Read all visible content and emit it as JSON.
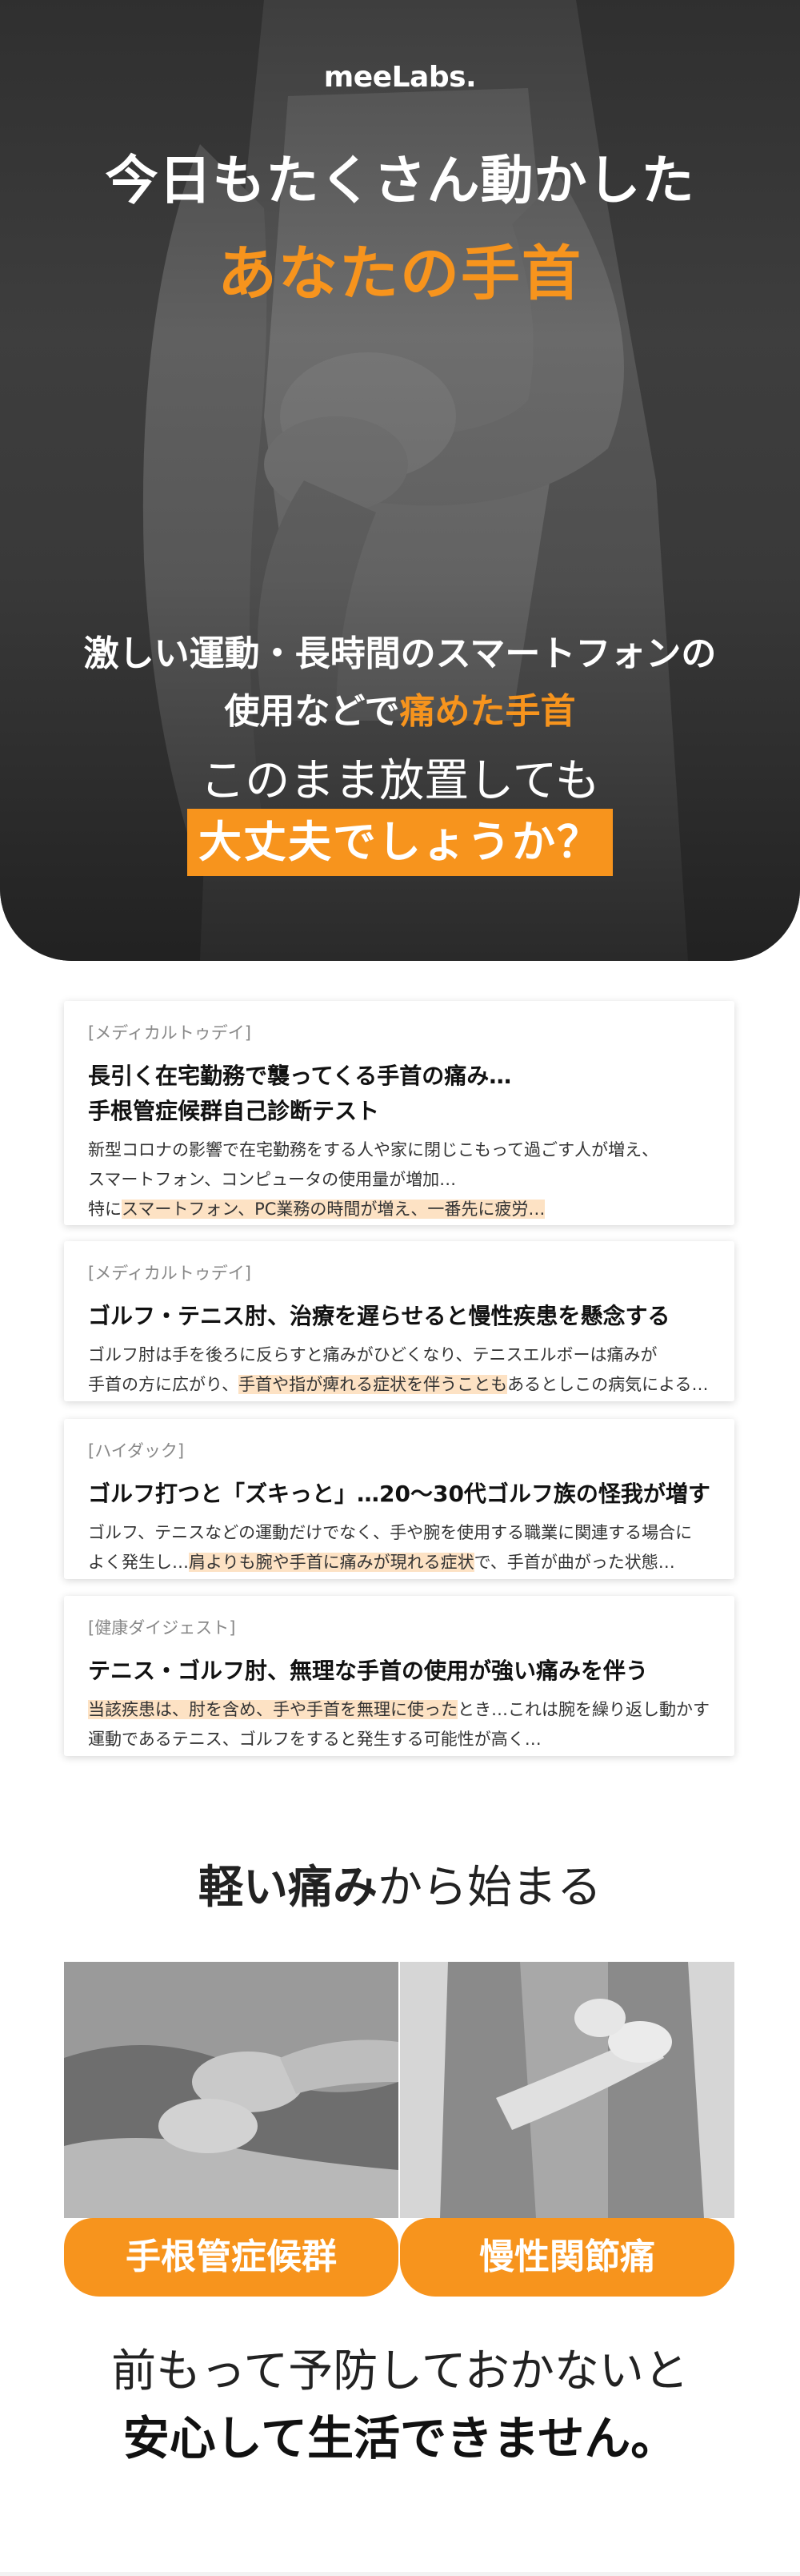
{
  "brand": {
    "logo": "meeLabs."
  },
  "hero": {
    "headline_line1": "今日もたくさん動かした",
    "headline_line2": "あなたの手首",
    "sub_line1": "激しい運動・長時間のスマートフォンの",
    "sub_line2_prefix": "使用などで",
    "sub_line2_highlight": "痛めた手首",
    "question_line1": "このまま放置しても",
    "question_line2": "大丈夫でしょうか？"
  },
  "news": [
    {
      "source": "[メディカルトゥデイ]",
      "title_line1": "長引く在宅勤務で襲ってくる手首の痛み…",
      "title_line2": "手根管症候群自己診断テスト",
      "body_line1": "新型コロナの影響で在宅勤務をする人や家に閉じこもって過ごす人が増え、",
      "body_line2": "スマートフォン、コンピュータの使用量が増加…",
      "body_line3_prefix": "特に",
      "body_line3_highlight": "スマートフォン、PC業務の時間が増え、一番先に疲労…"
    },
    {
      "source": "[メディカルトゥデイ]",
      "title": "ゴルフ・テニス肘、治療を遅らせると慢性疾患を懸念する",
      "body_line1": "ゴルフ肘は手を後ろに反らすと痛みがひどくなり、テニスエルボーは痛みが",
      "body_line2_prefix": "手首の方に広がり、",
      "body_line2_highlight": "手首や指が痺れる症状を伴うことも",
      "body_line2_suffix": "あるとしこの病気による…"
    },
    {
      "source": "[ハイダック]",
      "title": "ゴルフ打つと「ズキっと」…20～30代ゴルフ族の怪我が増す",
      "body_line1": "ゴルフ、テニスなどの運動だけでなく、手や腕を使用する職業に関連する場合に",
      "body_line2_prefix": "よく発生し…",
      "body_line2_highlight": "肩よりも腕や手首に痛みが現れる症状",
      "body_line2_suffix": "で、手首が曲がった状態…"
    },
    {
      "source": "[健康ダイジェスト]",
      "title": "テニス・ゴルフ肘、無理な手首の使用が強い痛みを伴う",
      "body_line1_highlight": "当該疾患は、肘を含め、手や手首を無理に使った",
      "body_line1_suffix": "とき…これは腕を繰り返し動かす",
      "body_line2": "運動であるテニス、ゴルフをすると発生する可能性が高く…"
    }
  ],
  "pain": {
    "heading_bold": "軽い痛み",
    "heading_rest": "から始まる",
    "cards": [
      {
        "label": "手根管症候群"
      },
      {
        "label": "慢性関節痛"
      }
    ]
  },
  "closing": {
    "line1": "前もって予防しておかないと",
    "line2": "安心して生活できません。"
  },
  "colors": {
    "accent": "#f7941d",
    "highlight": "#fde2c4",
    "hero_bg": "#3a3a3a"
  }
}
